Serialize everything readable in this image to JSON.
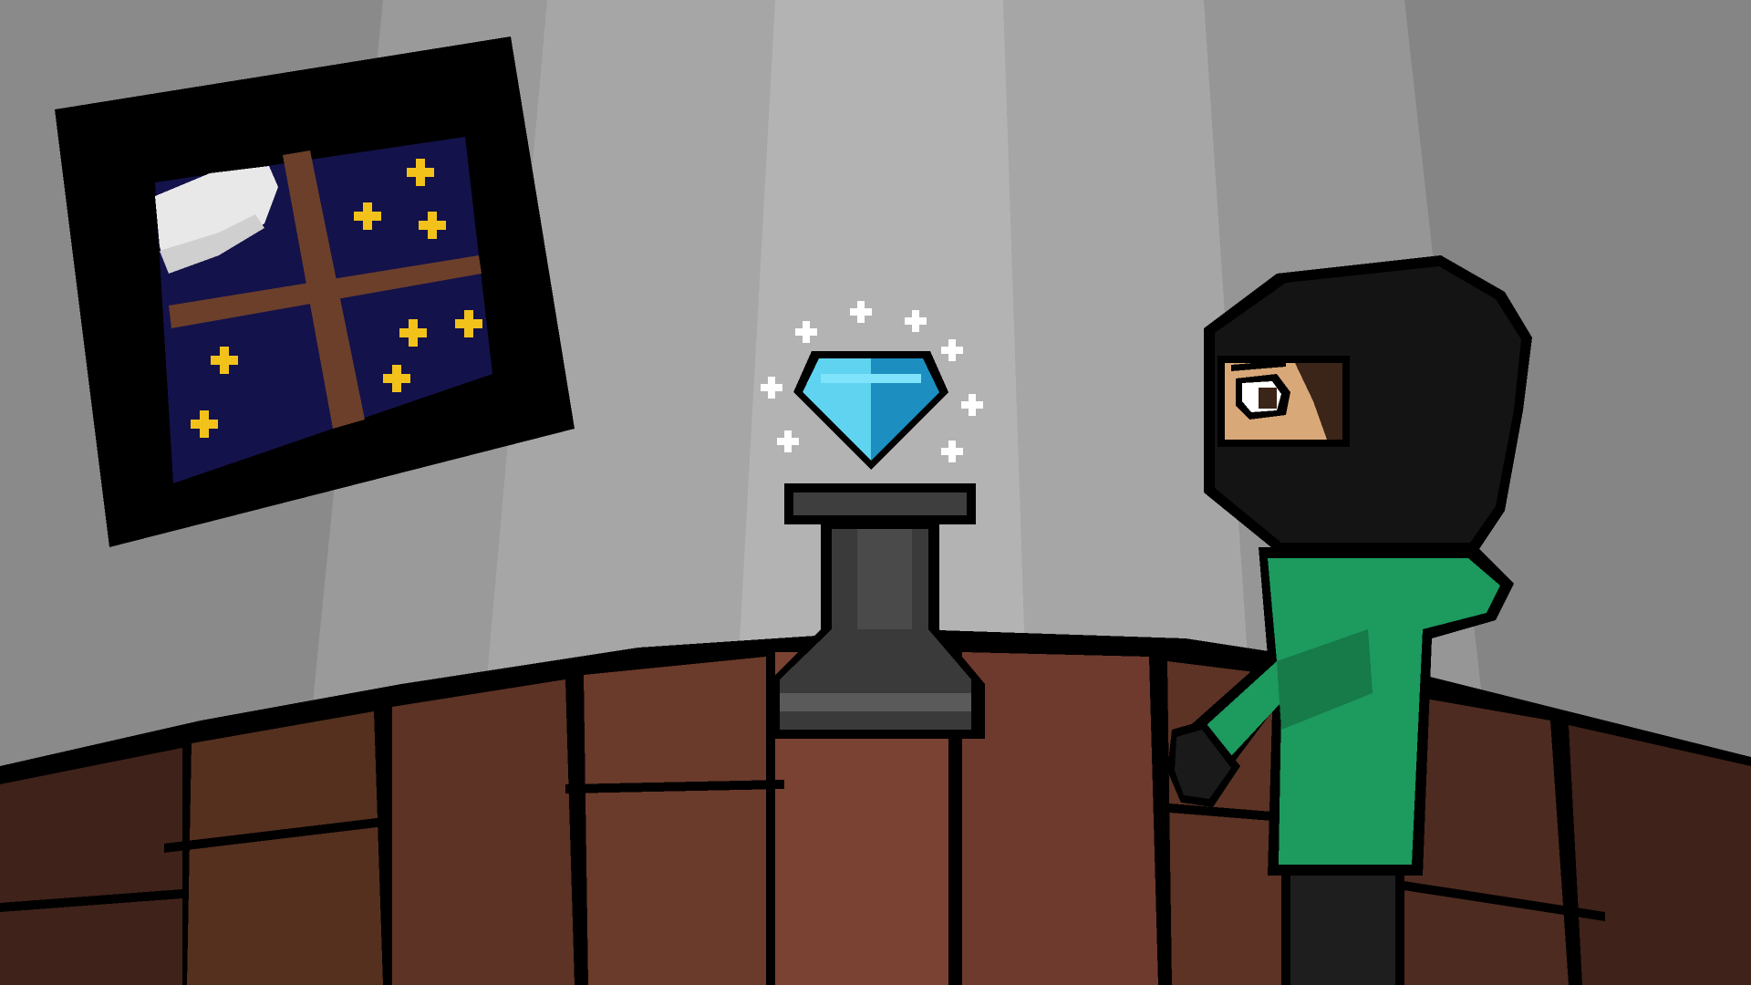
{
  "scene": {
    "description_visible_text": "",
    "palette": {
      "wall_far": "#7a7a7a",
      "wall_mid": "#8c8c8c",
      "wall_light": "#a3a3a3",
      "wall_lighter": "#b8b8b8",
      "spotlight": "#c4c4c4",
      "floor_brick_dark": "#4a2a22",
      "floor_brick": "#6e3a2e",
      "floor_brick_light": "#7e4434",
      "floor_grout": "#000000",
      "night_sky": "#14124a",
      "window_frame": "#000000",
      "window_mullion": "#6b3f2a",
      "moon": "#e8e8e8",
      "star": "#f2c21b",
      "gem_light": "#5fd3f0",
      "gem_mid": "#2bb4e0",
      "gem_dark": "#1c8fc0",
      "sparkle": "#ffffff",
      "pedestal_dark": "#2a2a2a",
      "pedestal": "#3e3e3e",
      "pedestal_light": "#5a5a5a",
      "mask": "#141414",
      "skin": "#d9a878",
      "hair": "#3b2418",
      "jacket": "#1d9a5e",
      "jacket_shadow": "#167a49",
      "pants": "#1e1e1e"
    },
    "objects": [
      {
        "name": "night-window",
        "icon": "window-icon"
      },
      {
        "name": "moon",
        "icon": "moon-icon"
      },
      {
        "name": "star-cluster",
        "icon": "star-icon",
        "count": 8
      },
      {
        "name": "diamond-gem",
        "icon": "diamond-icon"
      },
      {
        "name": "display-pedestal",
        "icon": "pedestal-icon"
      },
      {
        "name": "masked-thief",
        "icon": "thief-character-icon"
      },
      {
        "name": "brick-floor",
        "icon": "brick-icon"
      }
    ]
  }
}
